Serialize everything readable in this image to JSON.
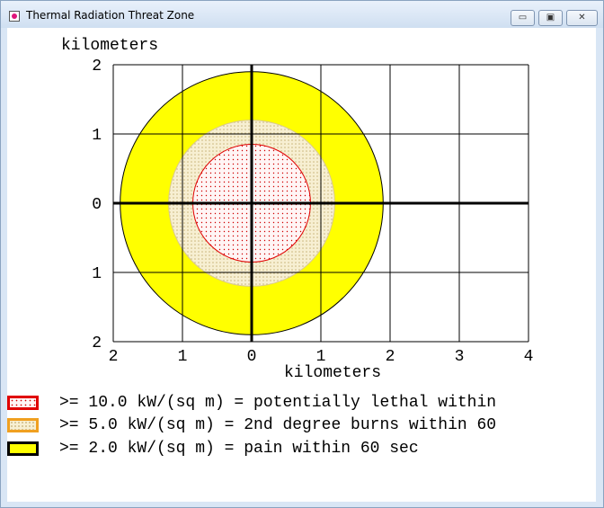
{
  "window": {
    "title": "Thermal Radiation Threat Zone",
    "controls": {
      "minimize": "▭",
      "maximize": "▣",
      "close": "✕"
    }
  },
  "plot": {
    "y_unit_label": "kilometers",
    "x_unit_label": "kilometers",
    "x_tick_labels": [
      "2",
      "1",
      "0",
      "1",
      "2",
      "3",
      "4"
    ],
    "y_tick_labels": [
      "2",
      "1",
      "0",
      "1",
      "2"
    ],
    "zones": [
      {
        "name": "pain",
        "radius_km": 1.9,
        "fill": "#ffff00",
        "stroke": "#000000"
      },
      {
        "name": "2nd-degree",
        "radius_km": 1.2,
        "fill": "#f3e9c4",
        "stroke": "#d9c98f"
      },
      {
        "name": "lethal",
        "radius_km": 0.85,
        "fill": "#fff2f2",
        "stroke": "#e00000"
      }
    ]
  },
  "legend": {
    "items": [
      {
        "text": ">= 10.0 kW/(sq m) = potentially lethal within",
        "border": "#e00000",
        "fill": "#fff5f5"
      },
      {
        "text": ">= 5.0 kW/(sq m) = 2nd degree burns within 60",
        "border": "#f0a020",
        "fill": "#f3e9c4"
      },
      {
        "text": ">= 2.0 kW/(sq m) = pain within 60 sec",
        "border": "#000000",
        "fill": "#ffff00"
      }
    ]
  }
}
